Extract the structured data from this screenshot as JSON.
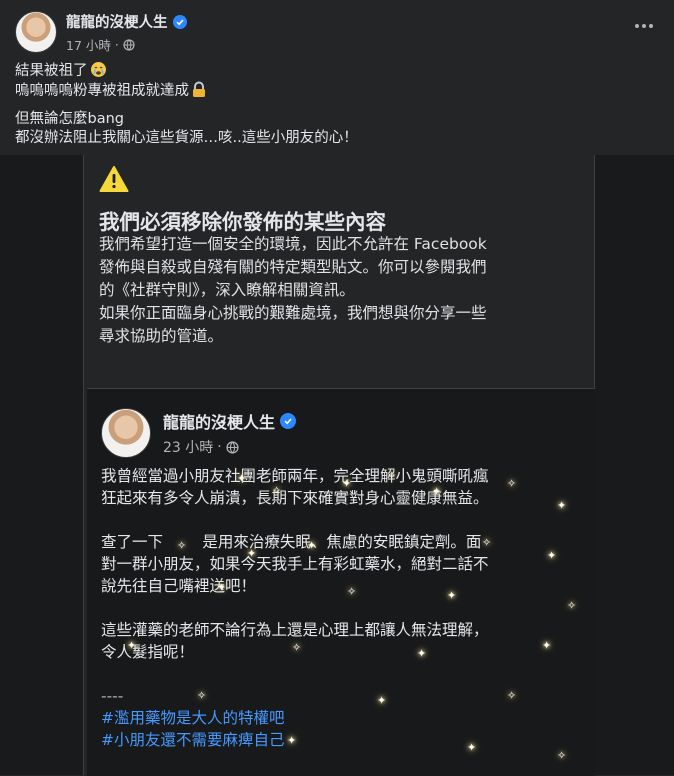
{
  "post": {
    "author": "龍龍的沒梗人生",
    "time": "17 小時",
    "separator": "·",
    "caption_lines": [
      "結果被祖了",
      "嗚嗚嗚嗚粉專被祖成就達成",
      "但無論怎麼bang",
      "都沒辦法阻止我關心這些貨源…咳..這些小朋友的心！"
    ],
    "icons": [
      "verified-badge-icon",
      "globe-icon",
      "more-options-icon",
      "crying-face-emoji",
      "padlock-emoji"
    ]
  },
  "notice": {
    "icon": "warning-icon",
    "title": "我們必須移除你發佈的某些內容",
    "lines": [
      "我們希望打造一個安全的環境，因此不允許在 Facebook",
      "發佈與自殺或自殘有關的特定類型貼文。你可以參閱我們",
      "的《社群守則》，深入瞭解相關資訊。",
      "如果你正面臨身心挑戰的艱難處境，我們想與你分享一些",
      "尋求協助的管道。"
    ]
  },
  "original_post": {
    "author": "龍龍的沒梗人生",
    "time": "23 小時",
    "separator": "·",
    "paragraphs": [
      [
        "我曾經當過小朋友社團老師兩年，完全理解小鬼頭嘶吼瘋",
        "狂起來有多令人崩潰，長期下來確實對身心靈健康無益。"
      ],
      [
        "查了一下        是用來治療失眠、焦慮的安眠鎮定劑。面",
        "對一群小朋友，如果今天我手上有彩虹藥水，絕對二話不",
        "說先往自己嘴裡送吧！"
      ],
      [
        "這些灌藥的老師不論行為上還是心理上都讓人無法理解，",
        "令人髮指呢！"
      ]
    ],
    "divider": "----",
    "hashtags": [
      "#濫用藥物是大人的特權吧",
      "#小朋友還不需要麻痺自己"
    ]
  },
  "colors": {
    "background": "#242526",
    "media_background": "#191a1b",
    "text": "#e4e6eb",
    "secondary": "#b0b3b8",
    "link": "#4599ff",
    "verified": "#2d88ff",
    "warning": "#f5d93b"
  }
}
